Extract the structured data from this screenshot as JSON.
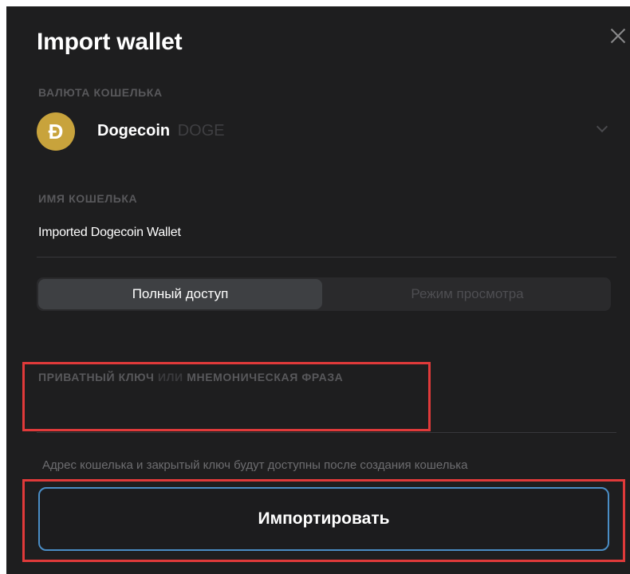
{
  "dialog": {
    "title": "Import wallet",
    "currency_label": "ВАЛЮТА КОШЕЛЬКА",
    "currency": {
      "name": "Dogecoin",
      "ticker": "DOGE",
      "icon_glyph": "Ð",
      "icon_color": "#c8a33c"
    },
    "wallet_name_label": "ИМЯ КОШЕЛЬКА",
    "wallet_name_value": "Imported Dogecoin Wallet",
    "access_tabs": [
      {
        "label": "Полный доступ",
        "active": true
      },
      {
        "label": "Режим просмотра",
        "active": false
      }
    ],
    "key_label_part1": "ПРИВАТНЫЙ КЛЮЧ",
    "key_label_or": "ИЛИ",
    "key_label_part2": "МНЕМОНИЧЕСКАЯ ФРАЗА",
    "key_input_value": "",
    "hint": "Адрес кошелька и закрытый ключ будут доступны после создания кошелька",
    "import_button": "Импортировать"
  },
  "colors": {
    "background": "#1e1e1f",
    "highlight": "#e03a3a",
    "button_border": "#4a8dc5"
  }
}
